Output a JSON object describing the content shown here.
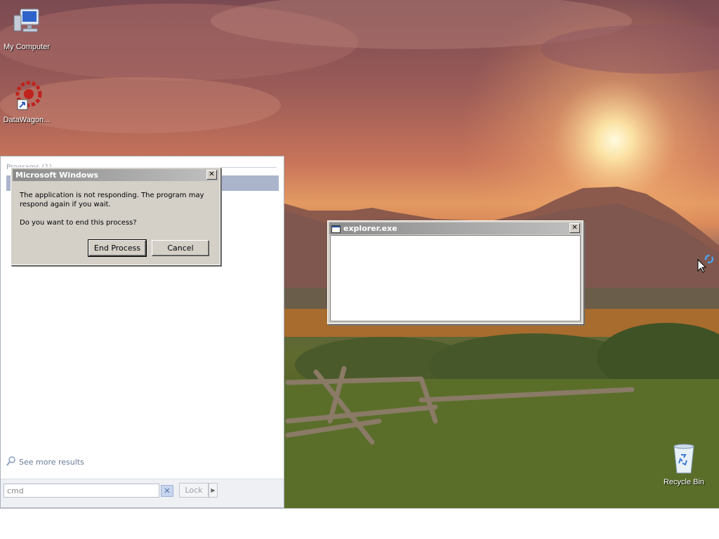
{
  "desktop": {
    "icons": [
      {
        "label": "My Computer",
        "icon": "computer-icon"
      },
      {
        "label": "DataWagon...",
        "icon": "datawagon-shortcut-icon"
      },
      {
        "label": "Recycle Bin",
        "icon": "recycle-bin-icon"
      }
    ]
  },
  "start_panel": {
    "section_header": "Programs (1)",
    "see_more": "See more results",
    "search_value": "cmd",
    "lock_label": "Lock",
    "icons": {
      "search": "magnifier-icon",
      "clear": "clear-search-icon",
      "arrow": "arrow-right-icon"
    }
  },
  "dialog": {
    "title": "Microsoft Windows",
    "message_line1": "The application is not responding. The program may",
    "message_line2": "respond again if you wait.",
    "question": "Do you want to end this process?",
    "end_process_label": "End Process",
    "cancel_label": "Cancel",
    "close_glyph": "✕"
  },
  "explorer_window": {
    "title": "explorer.exe",
    "close_glyph": "✕"
  },
  "colors": {
    "titlebar_inactive_start": "#8c8c8c",
    "titlebar_inactive_end": "#c0c0c0",
    "selection": "#aab5cc"
  }
}
